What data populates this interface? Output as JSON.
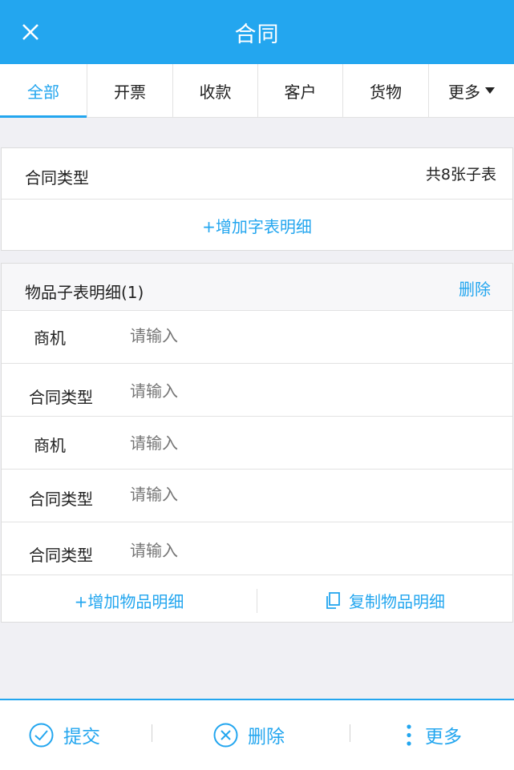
{
  "header": {
    "title": "合同"
  },
  "tabs": [
    {
      "label": "全部"
    },
    {
      "label": "开票"
    },
    {
      "label": "收款"
    },
    {
      "label": "客户"
    },
    {
      "label": "货物"
    },
    {
      "label": "更多"
    }
  ],
  "contract_type": {
    "label": "合同类型",
    "count": "共8张子表"
  },
  "add_subtable": {
    "label": "+增加字表明细"
  },
  "detail": {
    "title": "物品子表明细(1)",
    "delete_label": "删除",
    "fields": [
      {
        "label": "商机",
        "placeholder": "请输入"
      },
      {
        "label": "合同类型",
        "placeholder": "请输入"
      },
      {
        "label": "商机",
        "placeholder": "请输入"
      },
      {
        "label": "合同类型",
        "placeholder": "请输入"
      },
      {
        "label": "合同类型",
        "placeholder": "请输入"
      }
    ],
    "add_label": "+增加物品明细",
    "copy_label": "复制物品明细"
  },
  "bottom": {
    "submit": "提交",
    "delete": "删除",
    "more": "更多"
  },
  "colors": {
    "accent": "#23a6ef"
  }
}
